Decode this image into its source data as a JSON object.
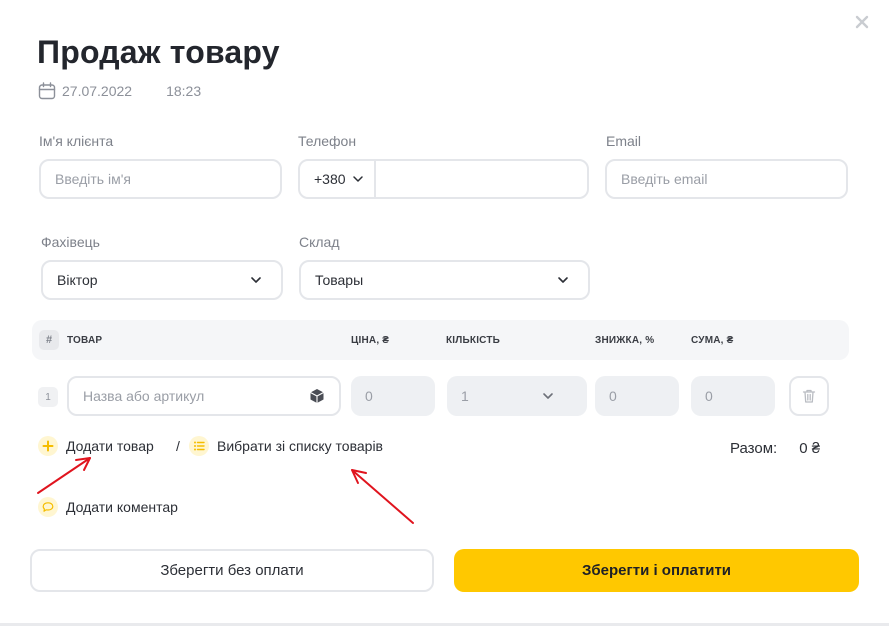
{
  "modal": {
    "title": "Продаж товару",
    "date": "27.07.2022",
    "time": "18:23"
  },
  "form": {
    "client_name": {
      "label": "Ім'я клієнта",
      "placeholder": "Введіть ім'я",
      "value": ""
    },
    "phone": {
      "label": "Телефон",
      "country_code": "+380",
      "value": ""
    },
    "email": {
      "label": "Email",
      "placeholder": "Введіть email",
      "value": ""
    },
    "specialist": {
      "label": "Фахівець",
      "value": "Віктор"
    },
    "warehouse": {
      "label": "Склад",
      "value": "Товары"
    }
  },
  "table": {
    "headers": {
      "num": "#",
      "product": "ТОВАР",
      "price": "ЦІНА, ₴",
      "quantity": "КІЛЬКІСТЬ",
      "discount": "ЗНИЖКА, %",
      "sum": "СУМА, ₴"
    },
    "rows": [
      {
        "num": "1",
        "product_placeholder": "Назва або артикул",
        "price": "0",
        "quantity": "1",
        "discount": "0",
        "sum": "0"
      }
    ]
  },
  "actions": {
    "add_product": "Додати товар",
    "separator": "/",
    "choose_from_list": "Вибрати зі списку товарів",
    "add_comment": "Додати коментар"
  },
  "total": {
    "label": "Разом:",
    "value": "0 ₴"
  },
  "buttons": {
    "save_without_payment": "Зберегти без оплати",
    "save_and_pay": "Зберегти і оплатити"
  },
  "colors": {
    "accent": "#ffc800",
    "icon_bg": "#fff6d1",
    "annotation_arrow": "#e0141e"
  }
}
